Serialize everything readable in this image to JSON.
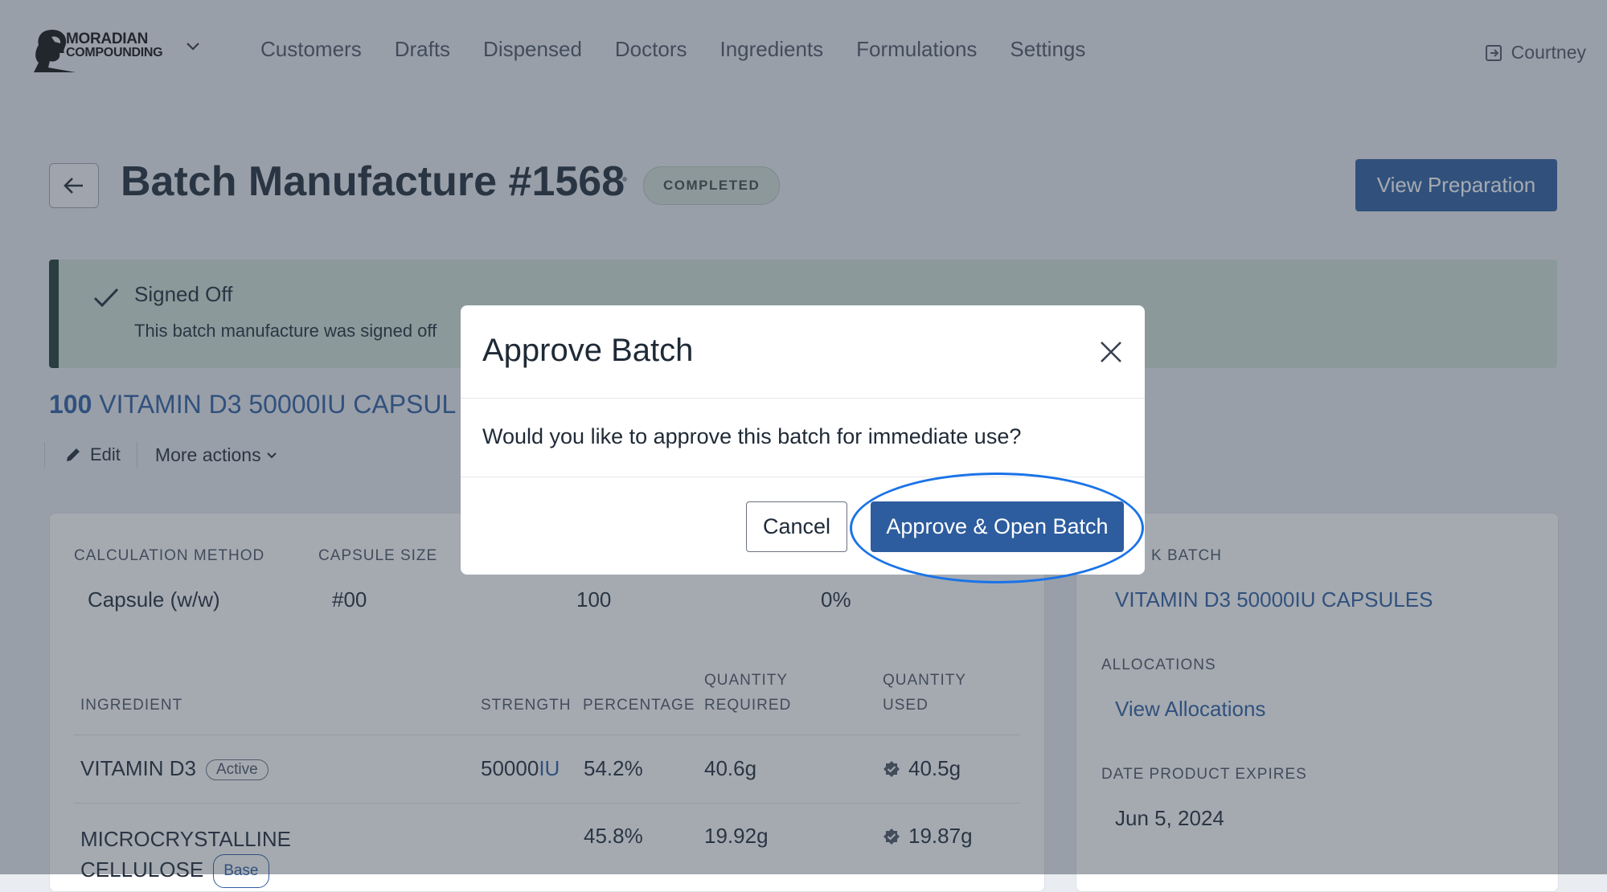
{
  "nav": {
    "brand_line1": "MORADIAN",
    "brand_line2": "COMPOUNDING",
    "items": [
      "Customers",
      "Drafts",
      "Dispensed",
      "Doctors",
      "Ingredients",
      "Formulations",
      "Settings"
    ],
    "user": "Courtney"
  },
  "header": {
    "title": "Batch Manufacture #1568",
    "status": "COMPLETED",
    "view_preparation": "View Preparation"
  },
  "alert": {
    "title": "Signed Off",
    "text": "This batch manufacture was signed off"
  },
  "product": {
    "quantity": "100",
    "name": "VITAMIN D3 50000IU CAPSUL"
  },
  "actions": {
    "edit": "Edit",
    "more": "More actions"
  },
  "details": {
    "calc_label": "CALCULATION METHOD",
    "calc_value": "Capsule (w/w)",
    "capsule_label": "CAPSULE SIZE",
    "capsule_value": "#00",
    "quantity_value": "100",
    "overage_value": "0%"
  },
  "table": {
    "headers": {
      "ingredient": "INGREDIENT",
      "strength": "STRENGTH",
      "percentage": "PERCENTAGE",
      "qty_required_1": "QUANTITY",
      "qty_required_2": "REQUIRED",
      "qty_used_1": "QUANTITY",
      "qty_used_2": "USED"
    },
    "rows": [
      {
        "ingredient": "VITAMIN D3",
        "tag": "Active",
        "strength_num": "50000",
        "strength_unit": "IU",
        "percentage": "54.2%",
        "required": "40.6g",
        "used": "40.5g"
      },
      {
        "ingredient_1": "MICROCRYSTALLINE",
        "ingredient_2": "CELLULOSE",
        "tag": "Base",
        "percentage": "45.8%",
        "required": "19.92g",
        "used": "19.87g"
      }
    ]
  },
  "side": {
    "batch_label": "K BATCH",
    "batch_value": "VITAMIN D3 50000IU CAPSULES",
    "alloc_label": "ALLOCATIONS",
    "alloc_link": "View Allocations",
    "expires_label": "DATE PRODUCT EXPIRES",
    "expires_value": "Jun 5, 2024"
  },
  "modal": {
    "title": "Approve Batch",
    "body": "Would you like to approve this batch for immediate use?",
    "cancel": "Cancel",
    "approve": "Approve & Open Batch"
  },
  "colors": {
    "primary": "#2d5d9e",
    "success_bg": "#cfe0d6",
    "highlight": "#1a73e8"
  }
}
